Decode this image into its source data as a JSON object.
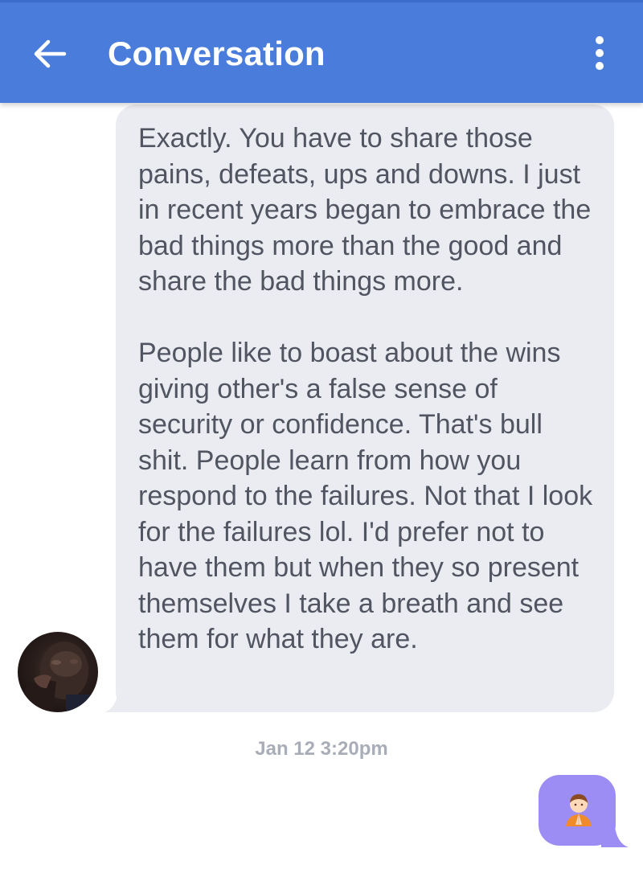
{
  "header": {
    "title": "Conversation",
    "back_icon": "arrow-left-icon",
    "menu_icon": "more-vertical-icon",
    "background_color": "#4a7ddb"
  },
  "messages": [
    {
      "direction": "received",
      "text": "Exactly. You have to share those pains, defeats, ups and downs. I just in recent years began to embrace the bad things more than the good and share the bad things more.\n\nPeople like to boast about the wins giving other's a false sense of security or confidence. That's bull shit. People learn from how you respond to the failures. Not that I look for the failures lol. I'd prefer not to have them but when they so present themselves I take a breath and see them for what they are.",
      "bubble_color": "#ebecf1"
    }
  ],
  "timestamp": "Jan 12 3:20pm",
  "sent": {
    "content_icon": "person-praying-emoji-icon",
    "bubble_color": "#9b8df3"
  }
}
